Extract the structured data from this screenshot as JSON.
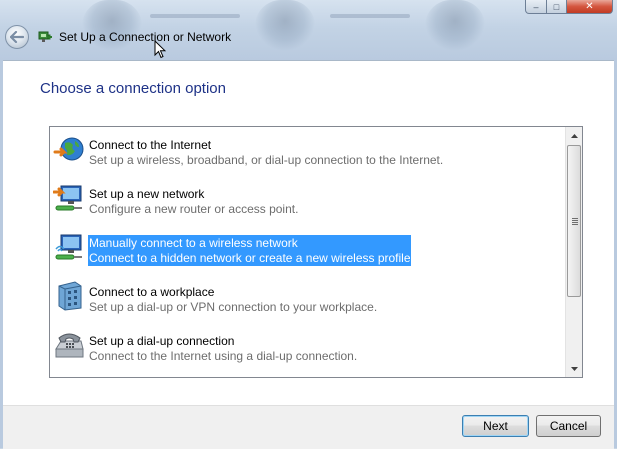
{
  "window": {
    "title": "Set Up a Connection or Network",
    "caption": {
      "minimize": "–",
      "maximize": "□",
      "close": "✕"
    }
  },
  "main": {
    "heading": "Choose a connection option",
    "options": [
      {
        "title": "Connect to the Internet",
        "description": "Set up a wireless, broadband, or dial-up connection to the Internet.",
        "icon": "globe-icon",
        "selected": false
      },
      {
        "title": "Set up a new network",
        "description": "Configure a new router or access point.",
        "icon": "new-network-icon",
        "selected": false
      },
      {
        "title": "Manually connect to a wireless network",
        "description": "Connect to a hidden network or create a new wireless profile.",
        "icon": "wireless-network-icon",
        "selected": true
      },
      {
        "title": "Connect to a workplace",
        "description": "Set up a dial-up or VPN connection to your workplace.",
        "icon": "workplace-icon",
        "selected": false
      },
      {
        "title": "Set up a dial-up connection",
        "description": "Connect to the Internet using a dial-up connection.",
        "icon": "dialup-phone-icon",
        "selected": false
      }
    ]
  },
  "footer": {
    "next_label": "Next",
    "cancel_label": "Cancel"
  },
  "colors": {
    "heading": "#1e3287",
    "selection": "#3399ff",
    "description": "#6d6d6d"
  }
}
